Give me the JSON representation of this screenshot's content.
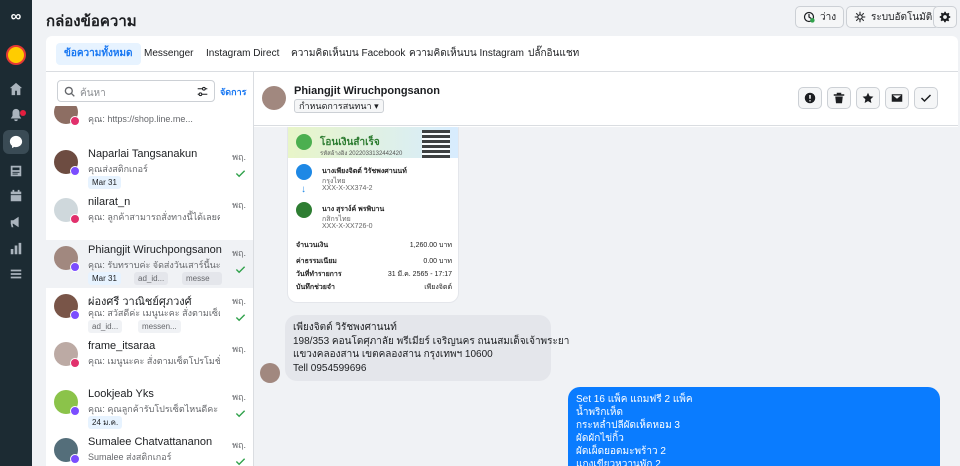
{
  "app": {
    "logo": "∞"
  },
  "rail": {
    "items": [
      "home-icon",
      "notifications-icon",
      "inbox-icon",
      "posts-icon",
      "calendar-icon",
      "ads-icon",
      "insights-icon",
      "menu-icon"
    ]
  },
  "topbar": {
    "title": "กล่องข้อความ",
    "status_label": "ว่าง",
    "automation_label": "ระบบอัตโนมัติ"
  },
  "tabs": [
    "ข้อความทั้งหมด",
    "Messenger",
    "Instagram Direct",
    "ความคิดเห็นบน Facebook",
    "ความคิดเห็นบน Instagram",
    "ปลั๊กอินแชท"
  ],
  "search": {
    "placeholder": "ค้นหา",
    "manage_label": "จัดการ"
  },
  "conversations": [
    {
      "name": "",
      "preview": "คุณ: https://shop.line.me...",
      "time": "",
      "channel": "instagram",
      "tags": []
    },
    {
      "name": "Naparlai Tangsanakun",
      "preview": "คุณส่งสติกเกอร์",
      "time": "พฤ.",
      "channel": "messenger",
      "tags": [
        "Mar 31"
      ]
    },
    {
      "name": "nilarat_n",
      "preview": "คุณ: ลูกค้าสามารถสั่งทางนี้ได้เลยค่ะ",
      "time": "พฤ.",
      "channel": "instagram",
      "tags": []
    },
    {
      "name": "Phiangjit Wiruchpongsanon",
      "preview": "คุณ: รับทราบค่ะ จัดส่งวันเสาร์นี้นะคะ",
      "time": "พฤ.",
      "channel": "messenger",
      "tags": [
        "Mar 31",
        "ad_id...",
        "messe"
      ]
    },
    {
      "name": "ผ่องศรี วาณิชย์ศุภวงศ์",
      "preview": "คุณ: สวัสดีค่ะ เมนูนะคะ สั่งตามเซ็ต",
      "time": "พฤ.",
      "channel": "messenger",
      "tags": [
        "ad_id...",
        "messen..."
      ]
    },
    {
      "name": "frame_itsaraa",
      "preview": "คุณ: เมนูนะคะ สั่งตามเซ็ตโปรโมชั่น",
      "time": "พฤ.",
      "channel": "instagram",
      "tags": []
    },
    {
      "name": "Lookjeab Yks",
      "preview": "คุณ: คุณลูกค้ารับโปรเซ็ตไหนดีคะ",
      "time": "พฤ.",
      "channel": "messenger",
      "tags": [
        "24 ม.ค."
      ]
    },
    {
      "name": "Sumalee Chatvattananon",
      "preview": "Sumalee ส่งสติกเกอร์",
      "time": "พฤ.",
      "channel": "messenger",
      "tags": []
    }
  ],
  "chat": {
    "contact_name": "Phiangjit Wiruchpongsanon",
    "assign_label": "กำหนดการสนทนา",
    "receipt": {
      "status": "โอนเงินสำเร็จ",
      "ref": "รหัสอ้างอิง 2022033132442420",
      "from_name": "นางเพียงจิตต์ วิรัชพงศานนท์",
      "from_bank": "กรุงไทย",
      "from_acct": "XXX-X-XX374-2",
      "to_name": "นาง สุราง์ค์ พรพิบาน",
      "to_bank": "กสิกรไทย",
      "to_acct": "XXX-X-XX726-0",
      "amount_label": "จำนวนเงิน",
      "amount": "1,260.00",
      "currency": "บาท",
      "fee_label": "ค่าธรรมเนียม",
      "fee": "0.00",
      "date_label": "วันที่ทำรายการ",
      "date": "31 มี.ค. 2565 - 17:17",
      "note_label": "บันทึกช่วยจำ",
      "note": "เพียงจิตต์"
    },
    "incoming_lines": [
      "เพียงจิตต์ วิรัชพงศานนท์",
      "198/353 คอนโดศุภาลัย พรีเมียร์ เจริญนคร ถนนสมเด็จเจ้าพระยา",
      "แขวงคลองสาน เขตคลองสาน กรุงเทพฯ 10600",
      "Tell  0954599696"
    ],
    "outgoing_lines": [
      "Set 16 แพ็ค แถมฟรี 2 แพ็ค",
      "น้ำพริกเห็ด",
      "กระหล่ำปลีผัดเห็ดหอม 3",
      "ผัดผักไข่กิ้ว",
      "ผัดเผ็ดยอดมะพร้าว 2",
      "แกงเขียวหวานพัก 2"
    ]
  },
  "colors": {
    "accent": "#1877f2",
    "bubble_out": "#0a7cff",
    "rail": "#1c2b33"
  }
}
